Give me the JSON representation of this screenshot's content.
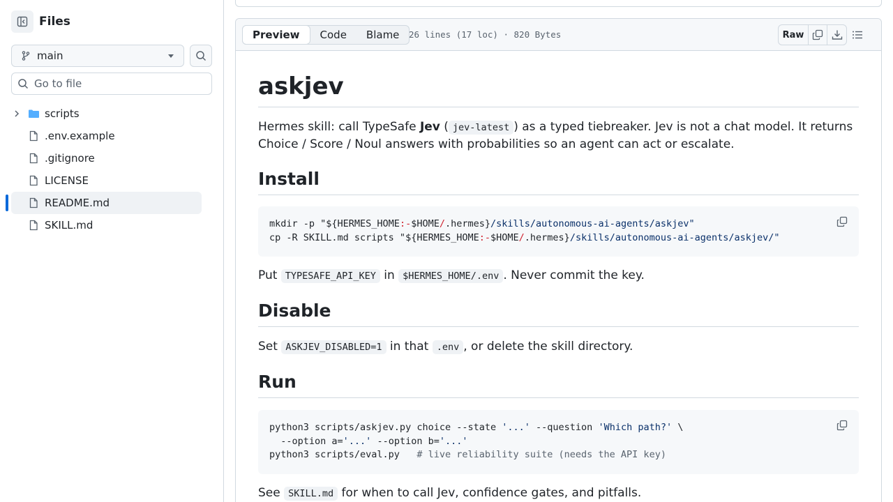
{
  "sidebar": {
    "title": "Files",
    "branch": "main",
    "search_placeholder": "Go to file",
    "items": [
      {
        "label": "scripts",
        "type": "folder"
      },
      {
        "label": ".env.example",
        "type": "file"
      },
      {
        "label": ".gitignore",
        "type": "file"
      },
      {
        "label": "LICENSE",
        "type": "file"
      },
      {
        "label": "README.md",
        "type": "file",
        "active": true
      },
      {
        "label": "SKILL.md",
        "type": "file"
      }
    ]
  },
  "file_header": {
    "tabs": [
      "Preview",
      "Code",
      "Blame"
    ],
    "selected_tab": "Preview",
    "loc_info": "26 lines (17 loc) · 820 Bytes",
    "raw_label": "Raw"
  },
  "readme": {
    "title": "askjev",
    "intro": {
      "p1": "Hermes skill: call TypeSafe ",
      "bold": "Jev",
      "p2": " (",
      "code": "jev-latest",
      "p3": ") as a typed tiebreaker. Jev is not a chat model. It returns Choice / Score / Noul answers with probabilities so an agent can act or escalate."
    },
    "install": {
      "heading": "Install",
      "code": [
        {
          "a": "mkdir -p \"${HERMES_HOME",
          "k1": ":-",
          "b": "$HOME",
          "k2": "/",
          "c": ".hermes}",
          "s": "/skills/autonomous-ai-agents/askjev\""
        },
        {
          "a": "cp -R SKILL.md scripts \"${HERMES_HOME",
          "k1": ":-",
          "b": "$HOME",
          "k2": "/",
          "c": ".hermes}",
          "s": "/skills/autonomous-ai-agents/askjev/\""
        }
      ],
      "note_p1": "Put ",
      "note_code1": "TYPESAFE_API_KEY",
      "note_p2": " in ",
      "note_code2": "$HERMES_HOME/.env",
      "note_p3": ". Never commit the key."
    },
    "disable": {
      "heading": "Disable",
      "p1": "Set ",
      "code1": "ASKJEV_DISABLED=1",
      "p2": " in that ",
      "code2": ".env",
      "p3": ", or delete the skill directory."
    },
    "run": {
      "heading": "Run",
      "line1_a": "python3 scripts/askjev.py choice --state ",
      "line1_s1": "'...'",
      "line1_b": " --question ",
      "line1_s2": "'Which path?'",
      "line1_c": " \\",
      "line2_a": "  --option a=",
      "line2_s1": "'...'",
      "line2_b": " --option b=",
      "line2_s2": "'...'",
      "line3_a": "python3 scripts/eval.py   ",
      "line3_c": "# live reliability suite (needs the API key)",
      "see_p1": "See ",
      "see_code": "SKILL.md",
      "see_p2": " for when to call Jev, confidence gates, and pitfalls."
    }
  },
  "colors": {
    "accent": "#0969da",
    "folder": "#54aeff",
    "border": "#d1d9e0"
  }
}
